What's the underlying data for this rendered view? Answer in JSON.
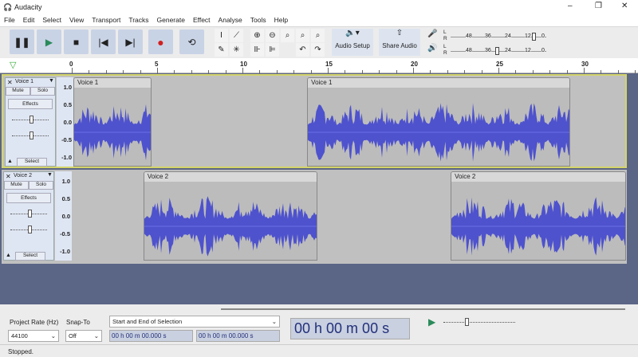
{
  "app": {
    "title": "Audacity",
    "status": "Stopped."
  },
  "menu": [
    "File",
    "Edit",
    "Select",
    "View",
    "Transport",
    "Tracks",
    "Generate",
    "Effect",
    "Analyse",
    "Tools",
    "Help"
  ],
  "toolbar": {
    "audio_setup": "Audio Setup",
    "share_audio": "Share Audio",
    "meter_ticks": [
      "48",
      "36",
      "24",
      "12",
      "0"
    ],
    "meter_lr": [
      "L",
      "R"
    ]
  },
  "ruler": {
    "ticks": [
      "0",
      "5",
      "10",
      "15",
      "20",
      "25",
      "30"
    ]
  },
  "tracks": [
    {
      "name": "Voice 1",
      "mute": "Mute",
      "solo": "Solo",
      "effects": "Effects",
      "select": "Select",
      "selected": true,
      "scale": [
        "1.0",
        "0.5",
        "0.0",
        "-0.5",
        "-1.0"
      ],
      "clips": [
        {
          "label": "Voice 1",
          "start": 0,
          "end": 4.6
        },
        {
          "label": "Voice 1",
          "start": 13.7,
          "end": 29.1
        }
      ]
    },
    {
      "name": "Voice 2",
      "mute": "Mute",
      "solo": "Solo",
      "effects": "Effects",
      "select": "Select",
      "selected": false,
      "scale": [
        "1.0",
        "0.5",
        "0.0",
        "-0.5",
        "-1.0"
      ],
      "clips": [
        {
          "label": "Voice 2",
          "start": 4.2,
          "end": 14.4
        },
        {
          "label": "Voice 2",
          "start": 22.2,
          "end": 32.5
        }
      ]
    }
  ],
  "bottom": {
    "project_rate_label": "Project Rate (Hz)",
    "project_rate": "44100",
    "snap_to_label": "Snap-To",
    "snap_to": "Off",
    "selection_mode": "Start and End of Selection",
    "sel_start": "00 h 00 m 00.000 s",
    "sel_end": "00 h 00 m 00.000 s",
    "position": "00 h 00 m 00 s"
  },
  "colors": {
    "waveform": "#3b3fd0",
    "track_bg": "#5b6585",
    "button": "#c9d3e6"
  }
}
